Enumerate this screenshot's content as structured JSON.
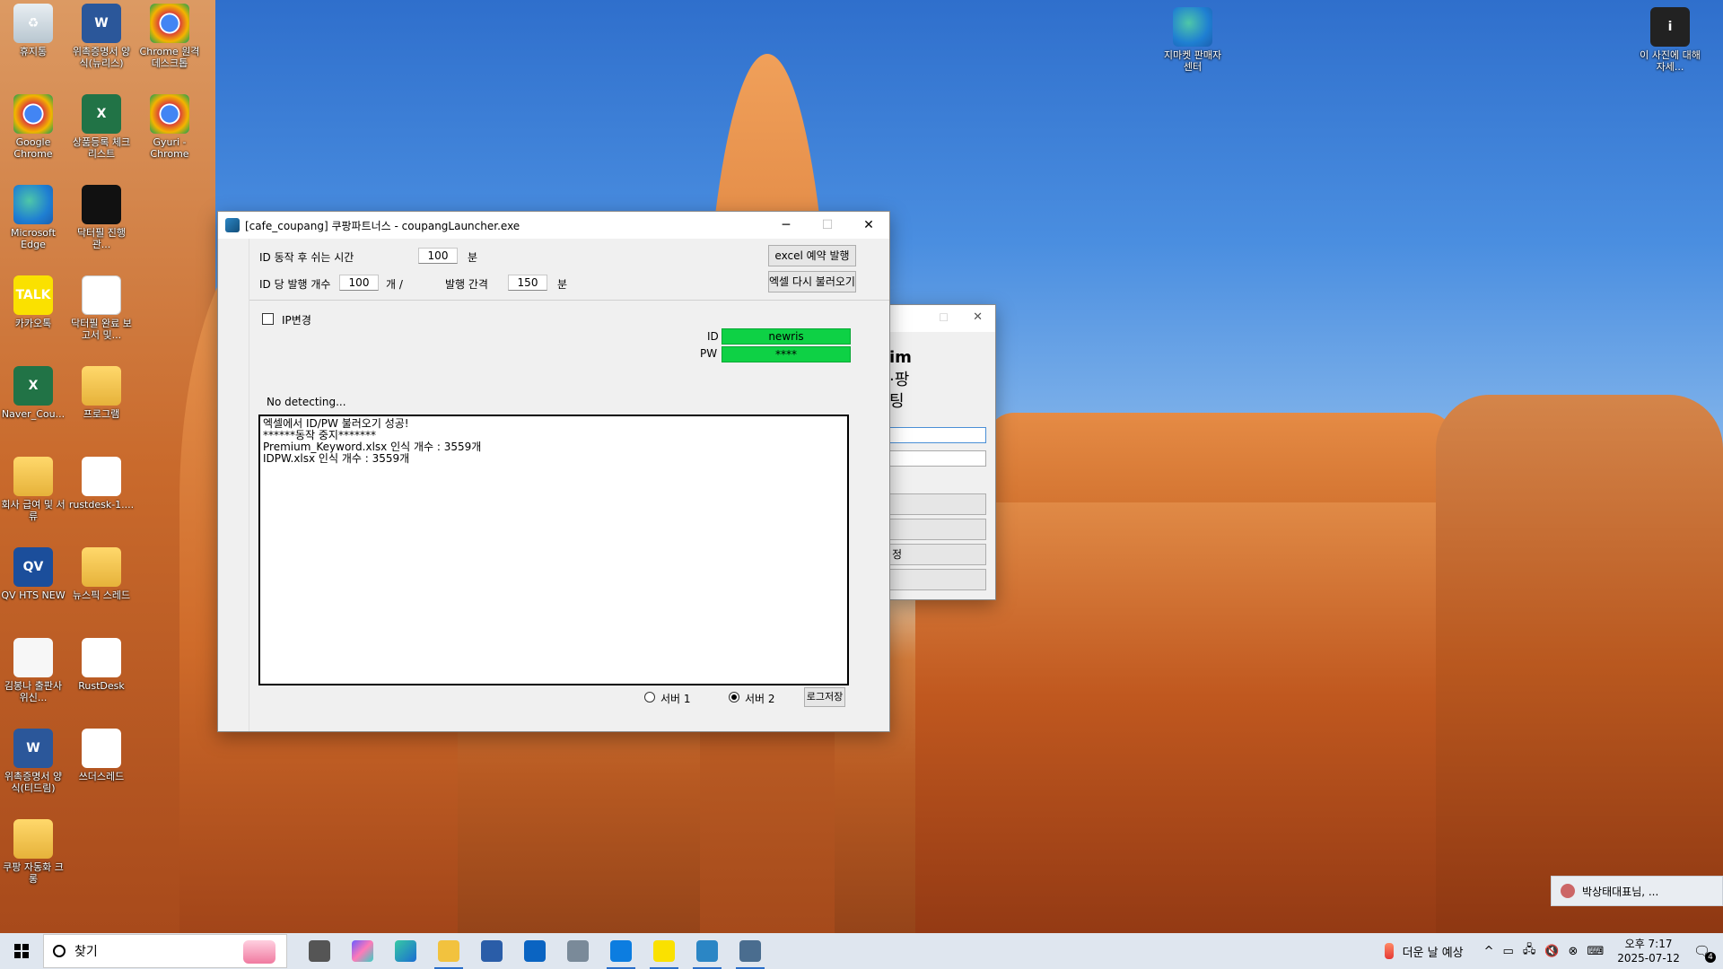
{
  "desktop": {
    "icons": [
      {
        "label": "휴지통",
        "glyph": "♻",
        "kind": "recycle-bin-icon"
      },
      {
        "label": "위촉증명서 양식(뉴리스)",
        "glyph": "W",
        "kind": "word-icon"
      },
      {
        "label": "Chrome 원격 데스크톱",
        "glyph": "",
        "kind": "chrome-remote-icon"
      },
      {
        "label": "Google Chrome",
        "glyph": "",
        "kind": "chrome-icon"
      },
      {
        "label": "상품등록 체크리스트",
        "glyph": "X",
        "kind": "excel-icon"
      },
      {
        "label": "Gyuri - Chrome",
        "glyph": "",
        "kind": "chrome-icon"
      },
      {
        "label": "Microsoft Edge",
        "glyph": "",
        "kind": "edge-icon"
      },
      {
        "label": "닥터필 진행관...",
        "glyph": "",
        "kind": "video-icon"
      },
      {
        "label": "카카오톡",
        "glyph": "TALK",
        "kind": "kakaotalk-icon"
      },
      {
        "label": "닥터필 완료 보고서 및...",
        "glyph": "PDF",
        "kind": "pdf-icon"
      },
      {
        "label": "Naver_Cou...",
        "glyph": "X",
        "kind": "excel-icon"
      },
      {
        "label": "프로그램",
        "glyph": "",
        "kind": "folder-icon"
      },
      {
        "label": "회사 급여 및 서류",
        "glyph": "",
        "kind": "folder-icon"
      },
      {
        "label": "rustdesk-1....",
        "glyph": "⟳",
        "kind": "rustdesk-icon"
      },
      {
        "label": "QV HTS NEW",
        "glyph": "QV",
        "kind": "qv-hts-icon"
      },
      {
        "label": "뉴스픽 스레드",
        "glyph": "",
        "kind": "folder-icon"
      },
      {
        "label": "김봉나 출판사위신...",
        "glyph": "",
        "kind": "document-icon"
      },
      {
        "label": "RustDesk",
        "glyph": "⟳",
        "kind": "rustdesk-icon"
      },
      {
        "label": "위촉증명서 양식(티드림)",
        "glyph": "W",
        "kind": "word-icon"
      },
      {
        "label": "쓰더스레드",
        "glyph": "ttt",
        "kind": "threads-icon"
      },
      {
        "label": "쿠팡 자동화 크롱",
        "glyph": "",
        "kind": "folder-icon"
      }
    ],
    "right_icons": [
      {
        "label": "지마켓 판매자센터",
        "kind": "edge-icon"
      },
      {
        "label": "이 사진에 대해 자세...",
        "kind": "info-icon"
      }
    ]
  },
  "window": {
    "title": "[cafe_coupang] 쿠팡파트너스 - coupangLauncher.exe",
    "minimize": "─",
    "maximize": "☐",
    "close": "✕",
    "rest_label": "ID 동작 후 쉬는 시간",
    "rest_value": "100",
    "rest_unit": "분",
    "per_id_label": "ID 당 발행 개수",
    "per_id_value": "100",
    "per_id_unit": "개 /",
    "interval_label": "발행 간격",
    "interval_value": "150",
    "interval_unit": "분",
    "excel_button": "excel 예약 발행",
    "reload_button": "엑셀 다시 불러오기",
    "ip_change_label": "IP변경",
    "ip_change_checked": false,
    "id_label": "ID",
    "id_value": "newris",
    "pw_label": "PW",
    "pw_value": "****",
    "status_text": "No detecting...",
    "log_lines": "엑셀에서 ID/PW 불러오기 성공!\n******동작 중지*******\nPremium_Keyword.xlsx 인식 개수 : 3559개\nIDPW.xlsx 인식 개수 : 3559개",
    "server1_label": "서버 1",
    "server2_label": "서버 2",
    "selected_server": "서버 2",
    "log_save_button": "로그저장",
    "accent_green": "#0ed145"
  },
  "back_window": {
    "partial_lines": [
      "im",
      "·팡",
      "팅"
    ],
    "button_fragment": "정"
  },
  "taskbar": {
    "search_placeholder": "찾기",
    "apps": [
      "task-view-icon",
      "copilot-icon",
      "edge-icon",
      "file-explorer-icon",
      "store-icon",
      "outlook-icon",
      "remote-desktop-icon",
      "rustdesk-icon",
      "kakaotalk-icon",
      "coupang-launcher-icon",
      "app-window-icon"
    ],
    "weather_text": "더운 날 예상",
    "clock_time": "오후 7:17",
    "clock_date": "2025-07-12",
    "notification_count": "4",
    "notification_text": "박상태대표님, ..."
  }
}
